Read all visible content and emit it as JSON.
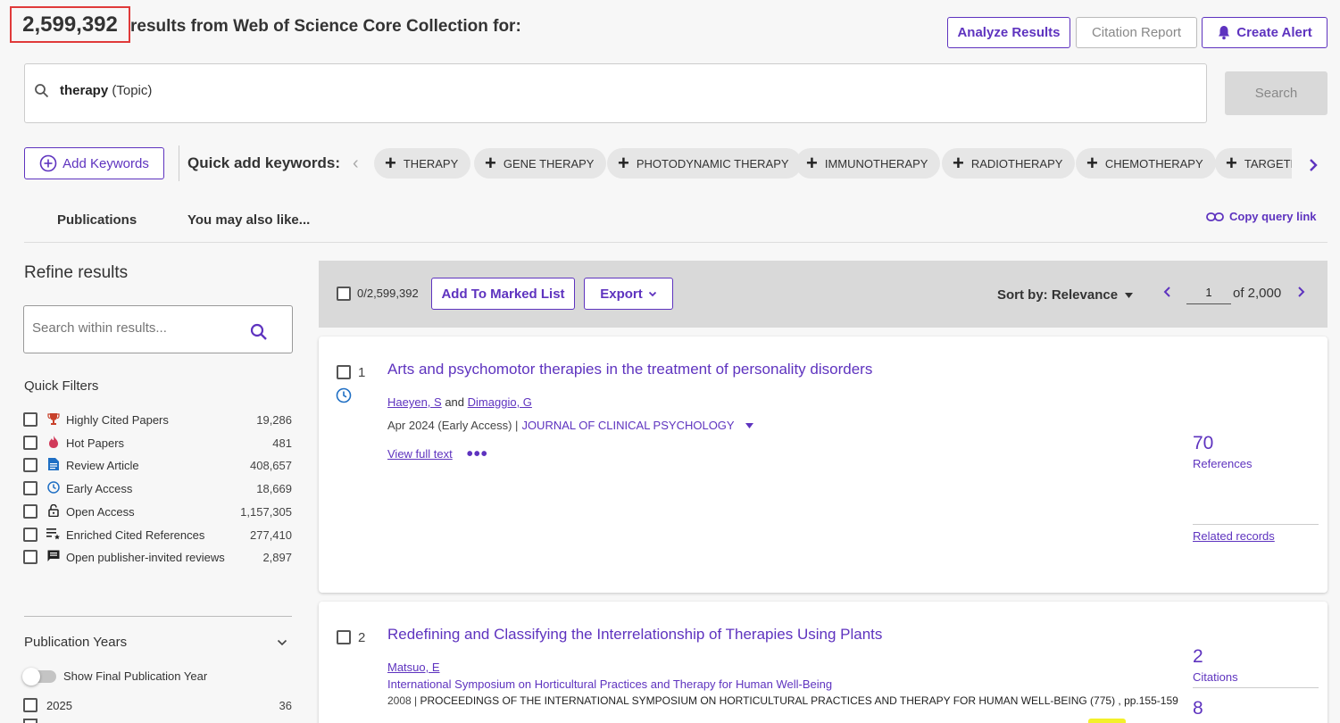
{
  "header": {
    "result_count": "2,599,392",
    "result_text": "results from Web of Science Core Collection for:",
    "analyze_label": "Analyze Results",
    "citation_label": "Citation Report",
    "alert_label": "Create Alert"
  },
  "search": {
    "query_term": "therapy",
    "query_field": "(Topic)",
    "search_button": "Search"
  },
  "keywords": {
    "add_label": "Add Keywords",
    "quick_label": "Quick add keywords:",
    "chips": [
      "THERAPY",
      "GENE THERAPY",
      "PHOTODYNAMIC THERAPY",
      "IMMUNOTHERAPY",
      "RADIOTHERAPY",
      "CHEMOTHERAPY",
      "TARGETE"
    ]
  },
  "tabs": {
    "publications": "Publications",
    "also_like": "You may also like...",
    "copy_link": "Copy query link"
  },
  "refine": {
    "title": "Refine results",
    "search_placeholder": "Search within results...",
    "quick_filters_title": "Quick Filters",
    "filters": [
      {
        "label": "Highly Cited Papers",
        "count": "19,286",
        "icon": "trophy-icon"
      },
      {
        "label": "Hot Papers",
        "count": "481",
        "icon": "flame-icon"
      },
      {
        "label": "Review Article",
        "count": "408,657",
        "icon": "document-icon"
      },
      {
        "label": "Early Access",
        "count": "18,669",
        "icon": "clock-icon"
      },
      {
        "label": "Open Access",
        "count": "1,157,305",
        "icon": "lock-open-icon"
      },
      {
        "label": "Enriched Cited References",
        "count": "277,410",
        "icon": "list-star-icon"
      },
      {
        "label": "Open publisher-invited reviews",
        "count": "2,897",
        "icon": "comment-icon"
      }
    ],
    "pub_years_title": "Publication Years",
    "show_final_label": "Show Final Publication Year",
    "year_row": {
      "label": "2025",
      "count": "36"
    }
  },
  "toolbar": {
    "selected": "0/2,599,392",
    "add_marked": "Add To Marked List",
    "export": "Export",
    "sort": "Sort by: Relevance",
    "page": "1",
    "of_pages": "of 2,000"
  },
  "records": [
    {
      "index": "1",
      "title": "Arts and psychomotor therapies in the treatment of personality disorders",
      "author1": "Haeyen, S",
      "and": "and",
      "author2": "Dimaggio, G",
      "date": "Apr 2024 (Early Access) |",
      "journal": "JOURNAL OF CLINICAL PSYCHOLOGY",
      "view_full": "View full text",
      "ref_count": "70",
      "ref_label": "References",
      "related": "Related records"
    },
    {
      "index": "2",
      "title": "Redefining and Classifying the Interrelationship of Therapies Using Plants",
      "author1": "Matsuo, E",
      "conference": "International Symposium on Horticultural Practices and Therapy for Human Well-Being",
      "source_prefix": "2008 |",
      "source": "PROCEEDINGS OF THE INTERNATIONAL SYMPOSIUM ON HORTICULTURAL PRACTICES AND THERAPY FOR HUMAN WELL-BEING (775) , pp.155-159",
      "cite_count": "2",
      "cite_label": "Citations",
      "second_count": "8"
    }
  ],
  "colors": {
    "accent": "#5e33bf",
    "highlight_box": "#e03a3a"
  }
}
